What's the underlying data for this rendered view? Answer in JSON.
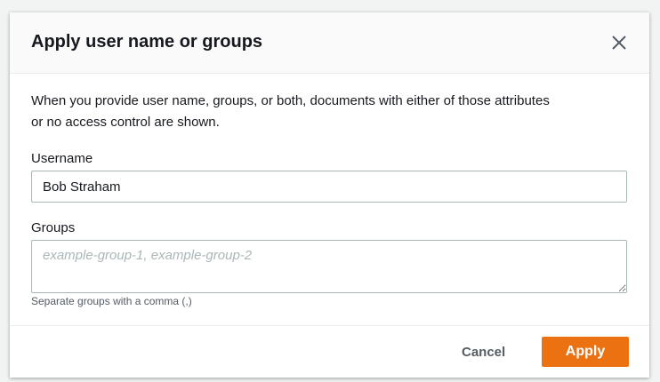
{
  "dialog": {
    "title": "Apply user name or groups",
    "description": "When you provide user name, groups, or both, documents with either of those attributes or no access control are shown.",
    "username_label": "Username",
    "username_value": "Bob Straham",
    "groups_label": "Groups",
    "groups_placeholder": "example-group-1, example-group-2",
    "groups_hint": "Separate groups with a comma (,)",
    "cancel_label": "Cancel",
    "apply_label": "Apply"
  },
  "colors": {
    "accent": "#ec7211"
  }
}
